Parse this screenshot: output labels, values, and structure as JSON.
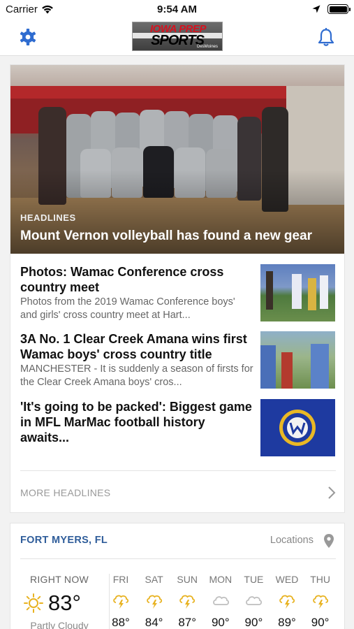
{
  "status_bar": {
    "carrier": "Carrier",
    "time": "9:54 AM"
  },
  "header": {
    "logo_line1": "IOWA PREP",
    "logo_line2": "SPORTS",
    "logo_tag": "DesMoines",
    "settings_icon": "gear-icon",
    "notifications_icon": "bell-icon",
    "accent_color": "#2f6cd0"
  },
  "hero": {
    "kicker": "HEADLINES",
    "title": "Mount Vernon volleyball has found a new gear"
  },
  "stories": [
    {
      "title": "Photos: Wamac Conference cross country meet",
      "description": "Photos from the 2019 Wamac Conference boys' and girls' cross country meet at Hart..."
    },
    {
      "title": "3A No. 1 Clear Creek Amana wins first Wamac boys' cross country title",
      "description": "MANCHESTER - It is suddenly a season of firsts for the Clear Creek Amana boys' cros..."
    },
    {
      "title": "'It's going to be packed': Biggest game in MFL MarMac football history awaits...",
      "description": ""
    }
  ],
  "more_headlines": "MORE HEADLINES",
  "weather": {
    "city": "FORT MYERS, FL",
    "locations_label": "Locations",
    "now": {
      "label": "RIGHT NOW",
      "temp": "83°",
      "condition": "Partly Cloudy",
      "icon": "sun-icon"
    },
    "forecast": [
      {
        "day": "FRI",
        "temp": "88°",
        "icon": "thunderstorm-icon"
      },
      {
        "day": "SAT",
        "temp": "84°",
        "icon": "thunderstorm-icon"
      },
      {
        "day": "SUN",
        "temp": "87°",
        "icon": "thunderstorm-icon"
      },
      {
        "day": "MON",
        "temp": "90°",
        "icon": "cloud-icon"
      },
      {
        "day": "TUE",
        "temp": "90°",
        "icon": "cloud-icon"
      },
      {
        "day": "WED",
        "temp": "89°",
        "icon": "thunderstorm-icon"
      },
      {
        "day": "THU",
        "temp": "90°",
        "icon": "thunderstorm-icon"
      }
    ]
  }
}
